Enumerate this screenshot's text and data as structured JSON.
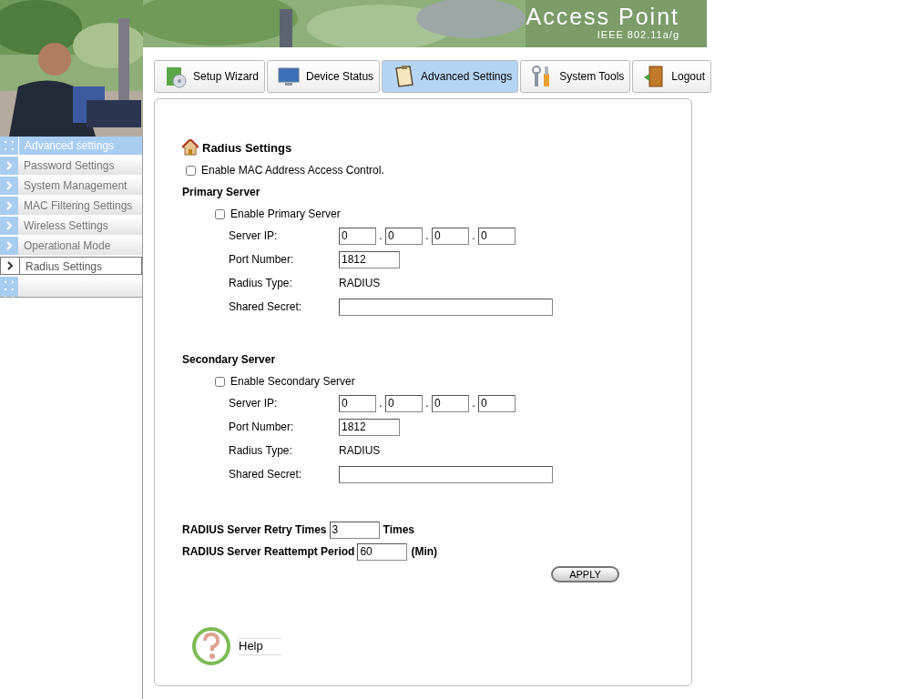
{
  "header": {
    "title": "Access Point",
    "subtitle": "IEEE 802.11a/g"
  },
  "tabs": [
    {
      "label": "Setup Wizard",
      "selected": false
    },
    {
      "label": "Device Status",
      "selected": false
    },
    {
      "label": "Advanced Settings",
      "selected": true
    },
    {
      "label": "System Tools",
      "selected": false
    },
    {
      "label": "Logout",
      "selected": false
    }
  ],
  "sidebar": {
    "header": "Advanced settings",
    "items": [
      {
        "label": "Password Settings",
        "selected": false
      },
      {
        "label": "System Management",
        "selected": false
      },
      {
        "label": "MAC Filtering Settings",
        "selected": false
      },
      {
        "label": "Wireless Settings",
        "selected": false
      },
      {
        "label": "Operational Mode",
        "selected": false
      },
      {
        "label": "Radius Settings",
        "selected": true
      }
    ]
  },
  "form": {
    "title": "Radius Settings",
    "mac_access_control": {
      "label": "Enable MAC Address Access Control.",
      "checked": false
    },
    "servers": [
      {
        "heading": "Primary Server",
        "enable": {
          "label": "Enable Primary Server",
          "checked": false
        },
        "rows": [
          {
            "kind": "ip",
            "label": "Server IP:",
            "octets": [
              "0",
              "0",
              "0",
              "0"
            ],
            "separators": [
              ".",
              ".",
              "."
            ]
          },
          {
            "kind": "short",
            "label": "Port Number:",
            "value": "1812"
          },
          {
            "kind": "text",
            "label": "Radius Type:",
            "value": "RADIUS"
          },
          {
            "kind": "long",
            "label": "Shared Secret:"
          }
        ]
      },
      {
        "heading": "Secondary Server",
        "enable": {
          "label": "Enable Secondary Server",
          "checked": false
        },
        "rows": [
          {
            "kind": "ip",
            "label": "Server IP:",
            "octets": [
              "0",
              "0",
              "0",
              "0"
            ],
            "separators": [
              ".",
              ".",
              "."
            ]
          },
          {
            "kind": "short",
            "label": "Port Number:",
            "value": "1812"
          },
          {
            "kind": "text",
            "label": "Radius Type:",
            "value": "RADIUS"
          },
          {
            "kind": "long",
            "label": "Shared Secret:"
          }
        ]
      }
    ],
    "retry": {
      "label": "RADIUS Server Retry Times",
      "value": "3",
      "unit": "Times"
    },
    "reattempt": {
      "label": "RADIUS Server Reattempt Period",
      "value": "60",
      "unit": "(Min)"
    },
    "apply": "APPLY",
    "help": "Help"
  }
}
